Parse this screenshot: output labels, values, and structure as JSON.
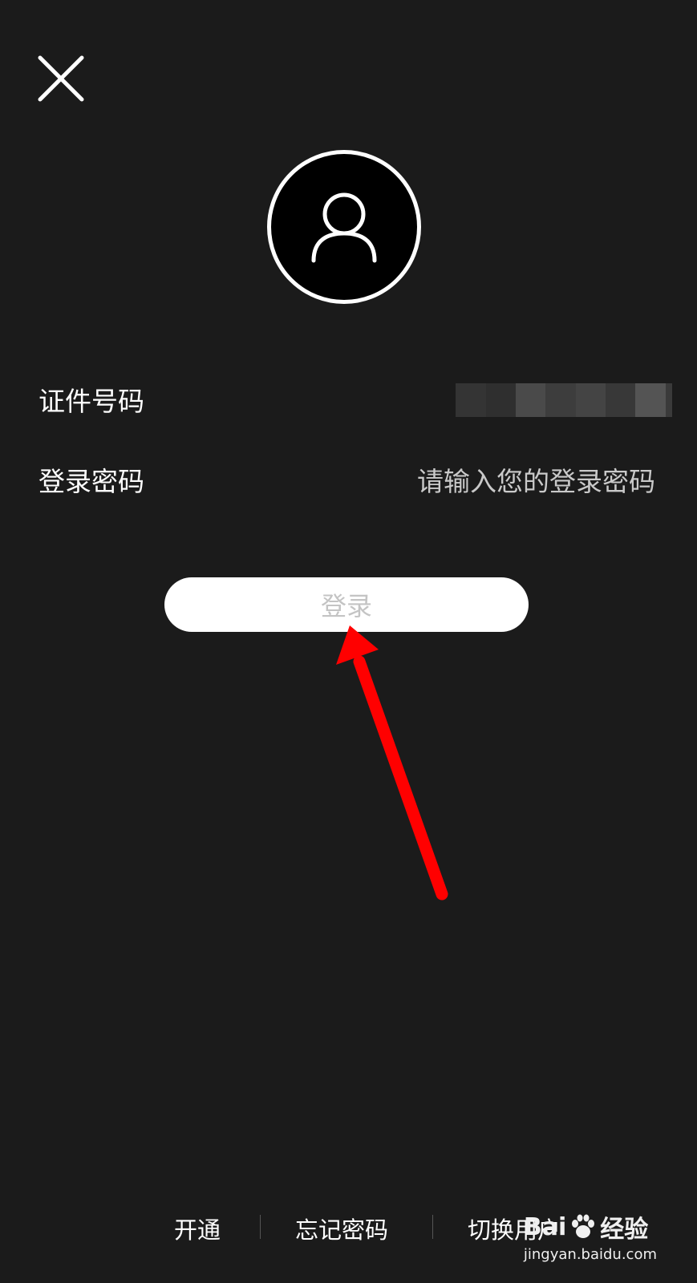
{
  "header": {
    "close_icon": "close-icon"
  },
  "avatar": {
    "icon": "user-icon"
  },
  "form": {
    "id_label": "证件号码",
    "password_label": "登录密码",
    "password_placeholder": "请输入您的登录密码"
  },
  "login_button": {
    "label": "登录"
  },
  "annotation": {
    "icon": "red-arrow-icon",
    "color": "#ff0000"
  },
  "footer": {
    "links": [
      "开通",
      "忘记密码",
      "切换用户"
    ]
  },
  "watermark": {
    "brand": "Bai",
    "brand_suffix": "经验",
    "url": "jingyan.baidu.com"
  },
  "colors": {
    "background": "#1b1b1b",
    "text": "#ffffff",
    "placeholder": "#c9c9c9",
    "button_bg": "#ffffff",
    "button_text": "#c4c4c4"
  }
}
